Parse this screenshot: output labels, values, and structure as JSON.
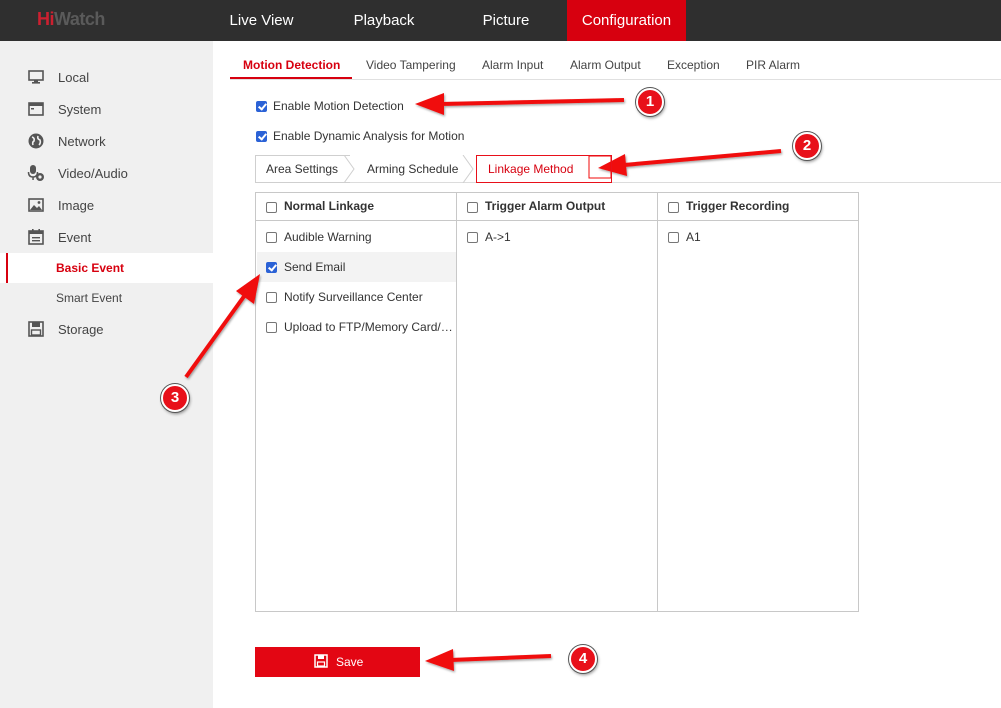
{
  "brand": {
    "logo_hi": "Hi",
    "logo_rest": "Watch",
    "accent": "#d7000f"
  },
  "nav": {
    "items": [
      {
        "label": "Live View"
      },
      {
        "label": "Playback"
      },
      {
        "label": "Picture"
      },
      {
        "label": "Configuration",
        "active": true
      }
    ]
  },
  "sidebar": {
    "items": [
      {
        "label": "Local",
        "icon": "monitor-icon"
      },
      {
        "label": "System",
        "icon": "window-icon"
      },
      {
        "label": "Network",
        "icon": "globe-icon"
      },
      {
        "label": "Video/Audio",
        "icon": "microphone-icon"
      },
      {
        "label": "Image",
        "icon": "image-icon"
      },
      {
        "label": "Event",
        "icon": "calendar-icon"
      },
      {
        "label": "Storage",
        "icon": "floppy-icon"
      }
    ],
    "sub_items": [
      {
        "label": "Basic Event",
        "active": true
      },
      {
        "label": "Smart Event"
      }
    ]
  },
  "subtabs": [
    {
      "label": "Motion Detection",
      "active": true
    },
    {
      "label": "Video Tampering"
    },
    {
      "label": "Alarm Input"
    },
    {
      "label": "Alarm Output"
    },
    {
      "label": "Exception"
    },
    {
      "label": "PIR Alarm"
    }
  ],
  "options": {
    "enable_motion": {
      "label": "Enable Motion Detection",
      "checked": true
    },
    "enable_dynamic": {
      "label": "Enable Dynamic Analysis for Motion",
      "checked": true
    }
  },
  "crumbs": [
    {
      "label": "Area Settings"
    },
    {
      "label": "Arming Schedule"
    },
    {
      "label": "Linkage Method",
      "active": true
    }
  ],
  "linkage": {
    "columns": [
      {
        "header": "Normal Linkage",
        "checked": false
      },
      {
        "header": "Trigger Alarm Output",
        "checked": false
      },
      {
        "header": "Trigger Recording",
        "checked": false
      }
    ],
    "normal": [
      {
        "label": "Audible Warning",
        "checked": false
      },
      {
        "label": "Send Email",
        "checked": true
      },
      {
        "label": "Notify Surveillance Center",
        "checked": false
      },
      {
        "label": "Upload to FTP/Memory Card/…",
        "checked": false
      }
    ],
    "alarm_output": [
      {
        "label": "A->1",
        "checked": false
      }
    ],
    "recording": [
      {
        "label": "A1",
        "checked": false
      }
    ]
  },
  "save_label": "Save",
  "annotations": [
    "1",
    "2",
    "3",
    "4"
  ],
  "annotation_color": "#e8101a"
}
